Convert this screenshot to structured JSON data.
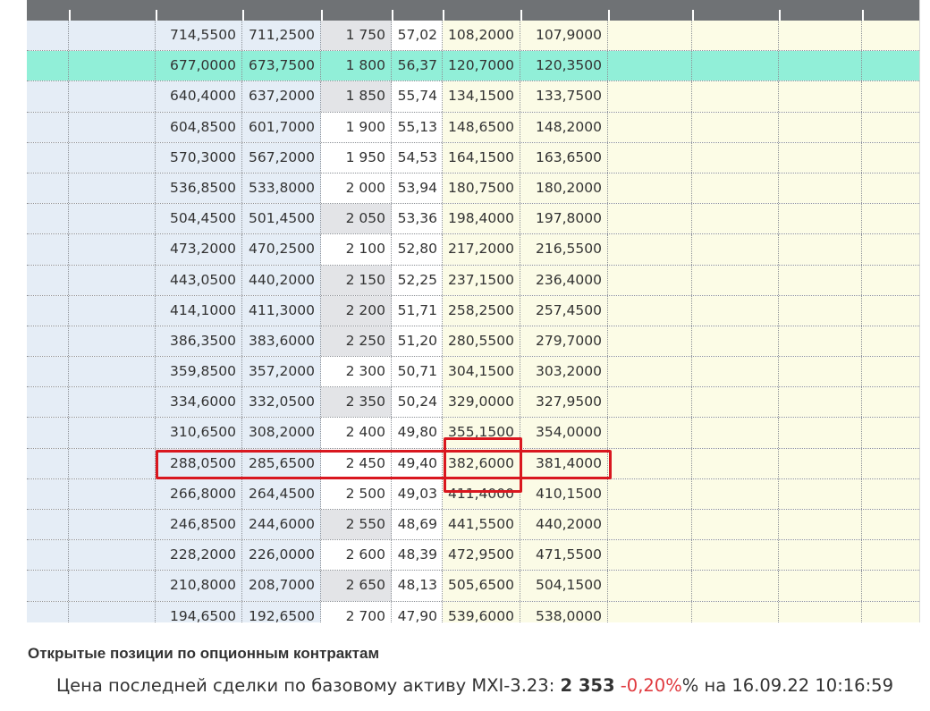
{
  "options_board": {
    "rows": [
      {
        "call_bid": "714,5500",
        "call_ask": "711,2500",
        "strike": "1 750",
        "vol": "57,02",
        "put_bid": "108,2000",
        "put_ask": "107,9000",
        "strike_shade": "gray",
        "highlight": false
      },
      {
        "call_bid": "677,0000",
        "call_ask": "673,7500",
        "strike": "1 800",
        "vol": "56,37",
        "put_bid": "120,7000",
        "put_ask": "120,3500",
        "strike_shade": "gray",
        "highlight": true
      },
      {
        "call_bid": "640,4000",
        "call_ask": "637,2000",
        "strike": "1 850",
        "vol": "55,74",
        "put_bid": "134,1500",
        "put_ask": "133,7500",
        "strike_shade": "gray",
        "highlight": false
      },
      {
        "call_bid": "604,8500",
        "call_ask": "601,7000",
        "strike": "1 900",
        "vol": "55,13",
        "put_bid": "148,6500",
        "put_ask": "148,2000",
        "strike_shade": "white",
        "highlight": false
      },
      {
        "call_bid": "570,3000",
        "call_ask": "567,2000",
        "strike": "1 950",
        "vol": "54,53",
        "put_bid": "164,1500",
        "put_ask": "163,6500",
        "strike_shade": "white",
        "highlight": false
      },
      {
        "call_bid": "536,8500",
        "call_ask": "533,8000",
        "strike": "2 000",
        "vol": "53,94",
        "put_bid": "180,7500",
        "put_ask": "180,2000",
        "strike_shade": "white",
        "highlight": false
      },
      {
        "call_bid": "504,4500",
        "call_ask": "501,4500",
        "strike": "2 050",
        "vol": "53,36",
        "put_bid": "198,4000",
        "put_ask": "197,8000",
        "strike_shade": "gray",
        "highlight": false
      },
      {
        "call_bid": "473,2000",
        "call_ask": "470,2500",
        "strike": "2 100",
        "vol": "52,80",
        "put_bid": "217,2000",
        "put_ask": "216,5500",
        "strike_shade": "white",
        "highlight": false
      },
      {
        "call_bid": "443,0500",
        "call_ask": "440,2000",
        "strike": "2 150",
        "vol": "52,25",
        "put_bid": "237,1500",
        "put_ask": "236,4000",
        "strike_shade": "gray",
        "highlight": false
      },
      {
        "call_bid": "414,1000",
        "call_ask": "411,3000",
        "strike": "2 200",
        "vol": "51,71",
        "put_bid": "258,2500",
        "put_ask": "257,4500",
        "strike_shade": "gray",
        "highlight": false
      },
      {
        "call_bid": "386,3500",
        "call_ask": "383,6000",
        "strike": "2 250",
        "vol": "51,20",
        "put_bid": "280,5500",
        "put_ask": "279,7000",
        "strike_shade": "gray",
        "highlight": false
      },
      {
        "call_bid": "359,8500",
        "call_ask": "357,2000",
        "strike": "2 300",
        "vol": "50,71",
        "put_bid": "304,1500",
        "put_ask": "303,2000",
        "strike_shade": "white",
        "highlight": false
      },
      {
        "call_bid": "334,6000",
        "call_ask": "332,0500",
        "strike": "2 350",
        "vol": "50,24",
        "put_bid": "329,0000",
        "put_ask": "327,9500",
        "strike_shade": "gray",
        "highlight": false
      },
      {
        "call_bid": "310,6500",
        "call_ask": "308,2000",
        "strike": "2 400",
        "vol": "49,80",
        "put_bid": "355,1500",
        "put_ask": "354,0000",
        "strike_shade": "white",
        "highlight": false
      },
      {
        "call_bid": "288,0500",
        "call_ask": "285,6500",
        "strike": "2 450",
        "vol": "49,40",
        "put_bid": "382,6000",
        "put_ask": "381,4000",
        "strike_shade": "white",
        "highlight": false
      },
      {
        "call_bid": "266,8000",
        "call_ask": "264,4500",
        "strike": "2 500",
        "vol": "49,03",
        "put_bid": "411,4000",
        "put_ask": "410,1500",
        "strike_shade": "white",
        "highlight": false
      },
      {
        "call_bid": "246,8500",
        "call_ask": "244,6000",
        "strike": "2 550",
        "vol": "48,69",
        "put_bid": "441,5500",
        "put_ask": "440,2000",
        "strike_shade": "gray",
        "highlight": false
      },
      {
        "call_bid": "228,2000",
        "call_ask": "226,0000",
        "strike": "2 600",
        "vol": "48,39",
        "put_bid": "472,9500",
        "put_ask": "471,5500",
        "strike_shade": "white",
        "highlight": false
      },
      {
        "call_bid": "210,8000",
        "call_ask": "208,7000",
        "strike": "2 650",
        "vol": "48,13",
        "put_bid": "505,6500",
        "put_ask": "504,1500",
        "strike_shade": "gray",
        "highlight": false
      },
      {
        "call_bid": "194,6500",
        "call_ask": "192,6500",
        "strike": "2 700",
        "vol": "47,90",
        "put_bid": "539,6000",
        "put_ask": "538,0000",
        "strike_shade": "white",
        "highlight": false
      }
    ],
    "colors": {
      "call_side": "#e5edf6",
      "put_side": "#fbfbe6",
      "highlight_row": "#91efd8",
      "strike_gray": "#e3e4e7",
      "header": "#6f7275",
      "annotation_red": "#d9171f"
    }
  },
  "section_title": "Открытые позиции по опционным контрактам",
  "price_line": {
    "prefix": "Цена последней сделки по базовому активу MXI-3.23: ",
    "price": "2 353",
    "change": "-0,20%",
    "suffix": "% на 16.09.22 10:16:59"
  }
}
